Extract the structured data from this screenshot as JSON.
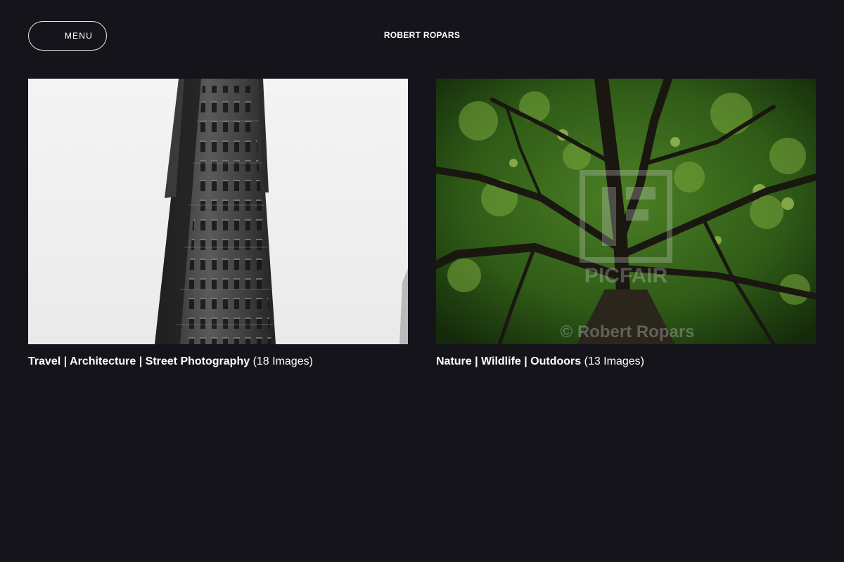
{
  "header": {
    "menu_label": "MENU",
    "site_title": "ROBERT ROPARS"
  },
  "galleries": [
    {
      "title": "Travel | Architecture | Street Photography",
      "count": "(18 Images)",
      "image_icon": "flatiron-building-photo"
    },
    {
      "title": "Nature | Wildlife | Outdoors",
      "count": "(13 Images)",
      "image_icon": "tree-canopy-photo",
      "watermark_brand": "PICFAIR",
      "watermark_credit": "© Robert Ropars"
    }
  ],
  "colors": {
    "background": "#15141b",
    "text": "#ffffff",
    "menu_border": "#e8e8ea"
  }
}
